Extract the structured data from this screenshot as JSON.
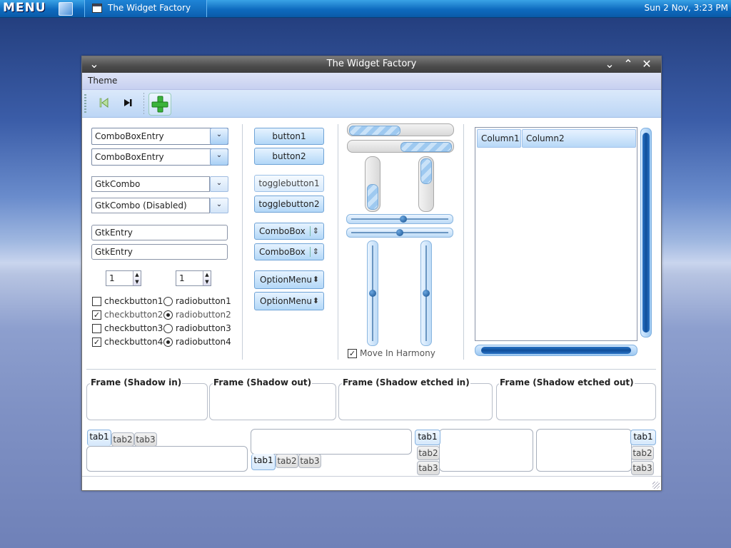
{
  "panel": {
    "menu_label": "MENU",
    "task_label": "The Widget Factory",
    "clock": "Sun  2 Nov,  3:23 PM"
  },
  "window": {
    "title": "The Widget Factory",
    "menu": {
      "theme": "Theme"
    },
    "combo_entries": [
      "ComboBoxEntry",
      "ComboBoxEntry"
    ],
    "gtk_combos": [
      "GtkCombo",
      "GtkCombo (Disabled)"
    ],
    "entries": [
      "GtkEntry",
      "GtkEntry"
    ],
    "spins": [
      "1",
      "1"
    ],
    "checkbuttons": [
      {
        "label": "checkbutton1",
        "checked": false
      },
      {
        "label": "checkbutton2",
        "checked": true
      },
      {
        "label": "checkbutton3",
        "checked": false
      },
      {
        "label": "checkbutton4",
        "checked": true
      }
    ],
    "radiobuttons": [
      {
        "label": "radiobutton1",
        "selected": false
      },
      {
        "label": "radiobutton2",
        "selected": true
      },
      {
        "label": "radiobutton3",
        "selected": false
      },
      {
        "label": "radiobutton4",
        "selected": true
      }
    ],
    "buttons": [
      "button1",
      "button2"
    ],
    "togglebuttons": [
      "togglebutton1",
      "togglebutton2"
    ],
    "comboboxes": [
      "ComboBox",
      "ComboBox"
    ],
    "optionmenus": [
      "OptionMenu",
      "OptionMenu"
    ],
    "move_in_harmony": {
      "label": "Move In Harmony",
      "checked": true
    },
    "tree_columns": [
      "Column1",
      "Column2"
    ],
    "frames": [
      "Frame (Shadow in)",
      "Frame (Shadow out)",
      "Frame (Shadow etched in)",
      "Frame (Shadow etched out)"
    ],
    "tabs": [
      "tab1",
      "tab2",
      "tab3"
    ]
  },
  "colors": {
    "accent": "#b2d7f7",
    "titlebar": "#4b4b4b",
    "panel": "#0e6bbf"
  }
}
